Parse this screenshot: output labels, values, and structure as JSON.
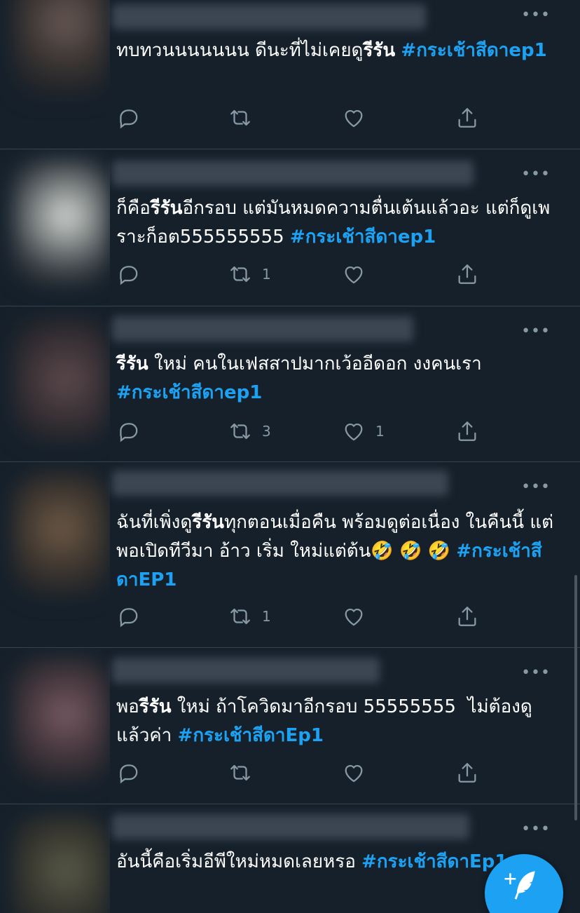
{
  "colors": {
    "background": "#15202b",
    "hashtag": "#1da1f2",
    "icon": "#8899a6",
    "divider": "#38444d",
    "compose": "#1da1f2"
  },
  "more_glyph": "•••",
  "tweets": [
    {
      "t1": "ทบทวนนนนนนน ดีนะที่ไม่เคยดู",
      "b1": "รีรัน",
      "t2": " ",
      "hash1": "#กระเช้าสีดาep1",
      "retweets": "",
      "likes": ""
    },
    {
      "t1": "ก็คือ",
      "b1": "รีรัน",
      "t2": "อีกรอบ แต่มันหมดความตื่นเต้นแล้วอะ แต่ก็ดูเพราะก็อต555555555 ",
      "hash1": "#กระเช้าสีดาep1",
      "retweets": "1",
      "likes": ""
    },
    {
      "t1": "",
      "b1": "รีรัน",
      "t2": " ใหม่ คนในเฟสสาปมากเว้ออีดอก งงคนเรา ",
      "hash1": "#กระเช้าสีดาep1",
      "retweets": "3",
      "likes": "1"
    },
    {
      "t1": "ฉันที่เพิ่งดู",
      "b1": "รีรัน",
      "t2": "ทุกตอนเมื่อคืน พร้อมดูต่อเนื่อง ในคืนนี้ แต่พอเปิดทีวีมา อ้าว เริ่ม ใหม่แต่ต้น🤣 🤣 🤣 ",
      "hash1": "#กระเช้าสีดาEP1",
      "retweets": "1",
      "likes": ""
    },
    {
      "t1": "พอ",
      "b1": "รีรัน",
      "t2": " ใหม่ ถ้าโควิดมาอีกรอบ 55555555  ไม่ต้องดูแล้วค่า ",
      "hash1": "#กระเช้าสีดาEp1",
      "retweets": "",
      "likes": ""
    },
    {
      "t1": "อันนี้คือเริ่มอีพีใหม่หมดเลยหรอ ",
      "b1": "",
      "t2": "",
      "hash1": "#กระเช้าสีดาEp1",
      "retweets": "",
      "likes": ""
    }
  ]
}
